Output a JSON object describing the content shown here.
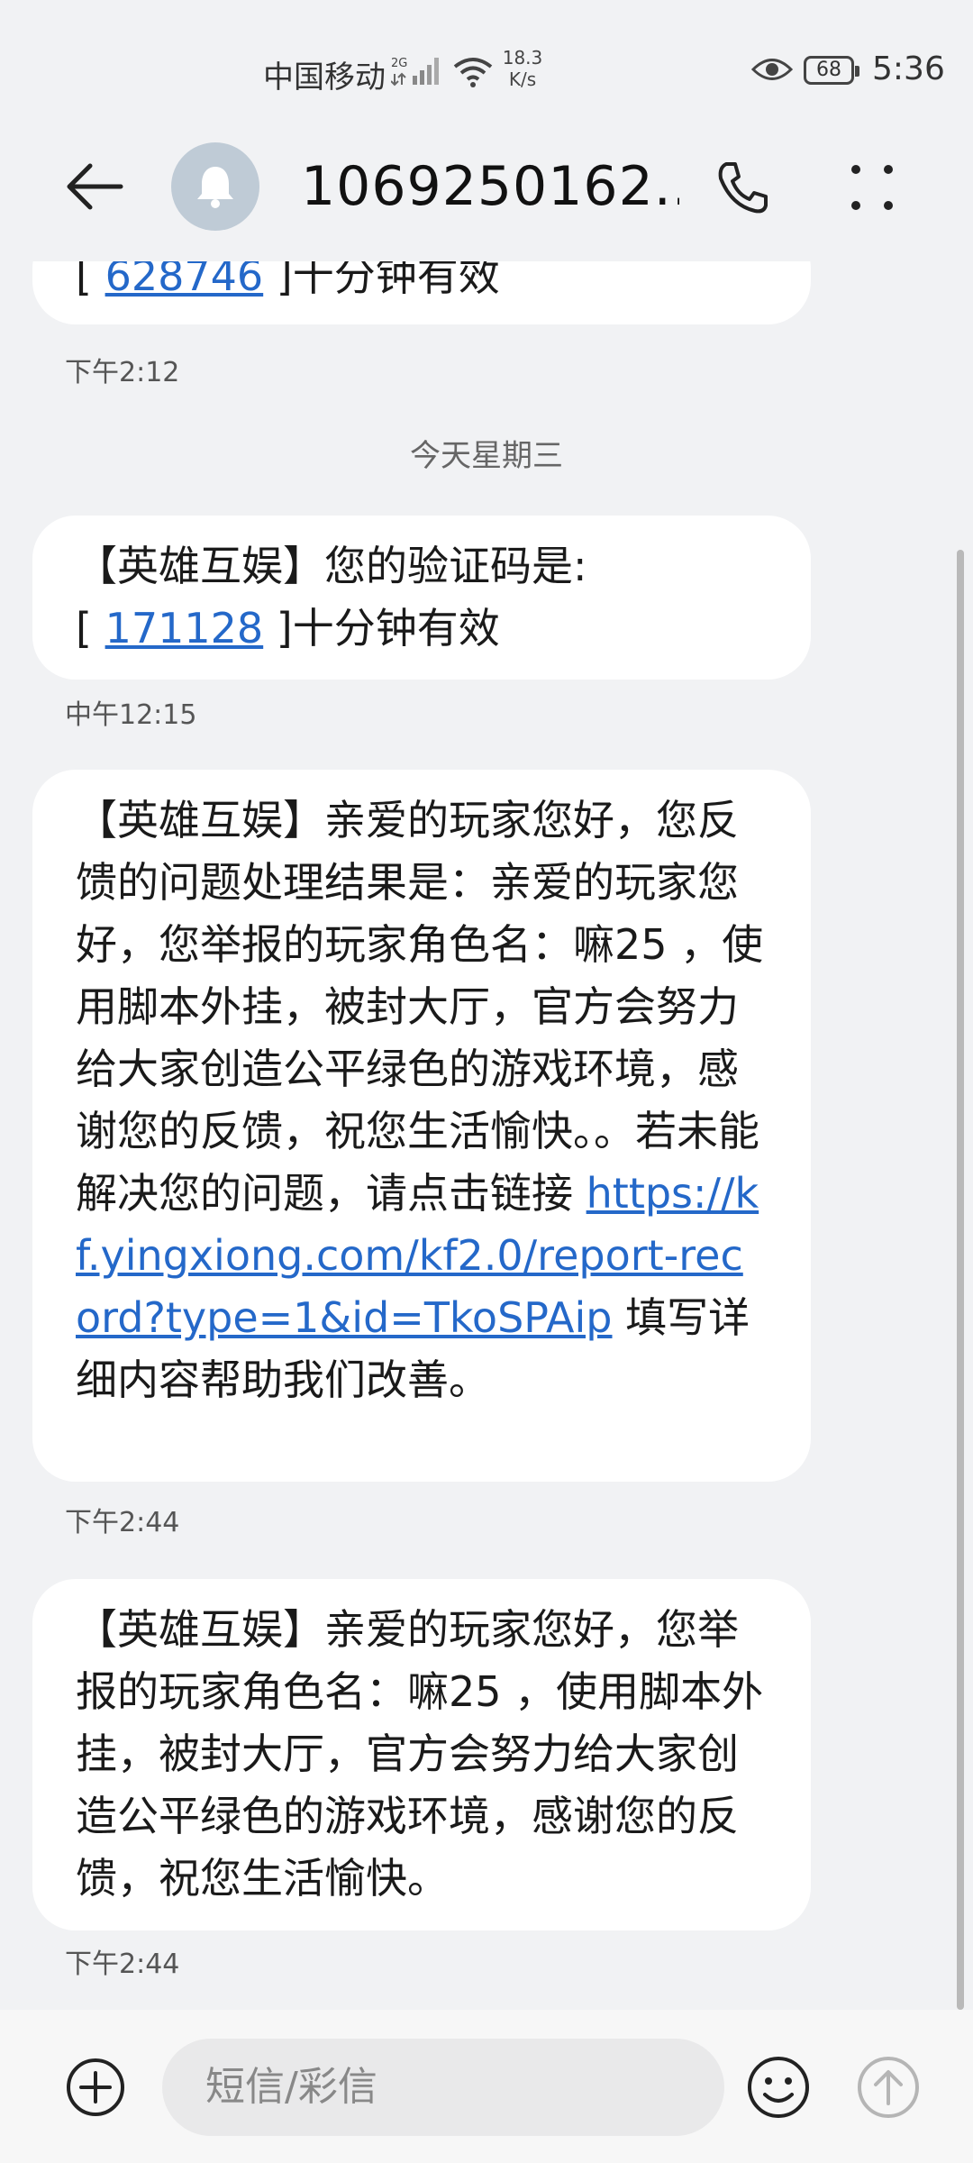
{
  "status_bar": {
    "carrier": "中国移动",
    "network": "2G",
    "speed_value": "18.3",
    "speed_unit": "K/s",
    "battery": "68",
    "time": "5:36"
  },
  "header": {
    "contact": "1069250162..."
  },
  "messages": [
    {
      "prefix": "[ ",
      "code": "628746",
      "suffix": " ]十分钟有效",
      "time": "下午2:12"
    },
    {
      "date_separator": "今天星期三"
    },
    {
      "line1": "【英雄互娱】您的验证码是:",
      "prefix": "[ ",
      "code": "171128",
      "suffix": " ]十分钟有效",
      "time": "中午12:15"
    },
    {
      "text_before": "【英雄互娱】亲爱的玩家您好，您反馈的问题处理结果是：亲爱的玩家您好，您举报的玩家角色名：嘛25 ，使用脚本外挂，被封大厅，官方会努力给大家创造公平绿色的游戏环境，感谢您的反馈，祝您生活愉快。。若未能解决您的问题，请点击链接 ",
      "link": "https://kf.yingxiong.com/kf2.0/report-record?type=1&id=TkoSPAip",
      "text_after": " 填写详细内容帮助我们改善。",
      "time": "下午2:44"
    },
    {
      "text": "【英雄互娱】亲爱的玩家您好，您举报的玩家角色名：嘛25 ，使用脚本外挂，被封大厅，官方会努力给大家创造公平绿色的游戏环境，感谢您的反馈，祝您生活愉快。",
      "time": "下午2:44"
    }
  ],
  "composer": {
    "placeholder": "短信/彩信"
  },
  "icons": [
    "back-arrow-icon",
    "bell-icon",
    "phone-icon",
    "more-icon",
    "add-icon",
    "emoji-icon",
    "send-icon",
    "wifi-icon",
    "eye-icon",
    "signal-icon"
  ]
}
